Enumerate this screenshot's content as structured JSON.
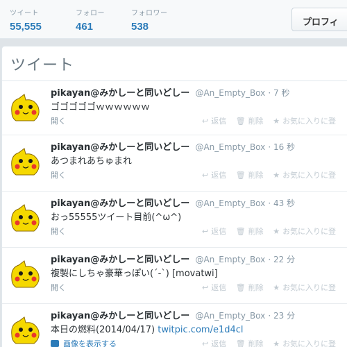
{
  "stats": [
    {
      "label": "ツイート",
      "value": "55,555"
    },
    {
      "label": "フォロー",
      "value": "461"
    },
    {
      "label": "フォロワー",
      "value": "538"
    }
  ],
  "profile_button": "プロフィ",
  "timeline": {
    "title": "ツイート"
  },
  "actions": {
    "reply": "返信",
    "delete": "削除",
    "favorite": "お気に入りに登",
    "expand": "開く"
  },
  "tweets": [
    {
      "fullname": "pikayan@みかしーと同いどしー",
      "username": "@An_Empty_Box",
      "time": "· 7 秒",
      "text": "ゴゴゴゴゴｗｗｗｗｗｗ"
    },
    {
      "fullname": "pikayan@みかしーと同いどしー",
      "username": "@An_Empty_Box",
      "time": "· 16 秒",
      "text": "あつまれあちゅまれ"
    },
    {
      "fullname": "pikayan@みかしーと同いどしー",
      "username": "@An_Empty_Box",
      "time": "· 43 秒",
      "text": "おっ55555ツイート目前(^ω^)"
    },
    {
      "fullname": "pikayan@みかしーと同いどしー",
      "username": "@An_Empty_Box",
      "time": "· 22 分",
      "text": "複製にしちゃ豪華っぽい(´-`) [movatwi]"
    },
    {
      "fullname": "pikayan@みかしーと同いどしー",
      "username": "@An_Empty_Box",
      "time": "· 23 分",
      "text": "本日の燃料(2014/04/17) ",
      "link": "twitpic.com/e1d4cl",
      "media": "画像を表示する"
    }
  ],
  "icons": {
    "reply": "reply-icon",
    "delete": "trash-icon",
    "favorite": "star-icon",
    "media": "photo-icon"
  },
  "colors": {
    "link": "#2b7bb9",
    "stat_value": "#2b7bb9",
    "avatar_yellow": "#f5d800"
  }
}
